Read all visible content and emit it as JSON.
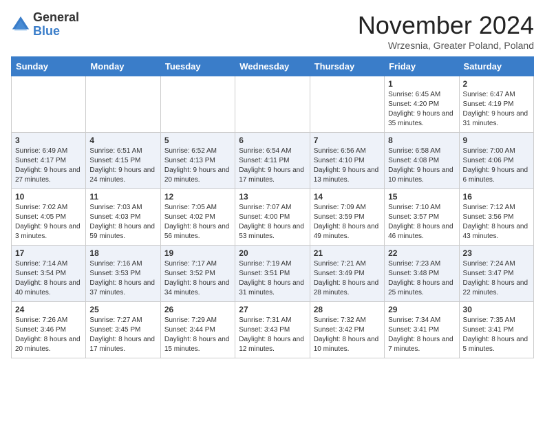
{
  "header": {
    "logo_line1": "General",
    "logo_line2": "Blue",
    "month": "November 2024",
    "location": "Wrzesnia, Greater Poland, Poland"
  },
  "days_of_week": [
    "Sunday",
    "Monday",
    "Tuesday",
    "Wednesday",
    "Thursday",
    "Friday",
    "Saturday"
  ],
  "weeks": [
    [
      {
        "day": "",
        "info": ""
      },
      {
        "day": "",
        "info": ""
      },
      {
        "day": "",
        "info": ""
      },
      {
        "day": "",
        "info": ""
      },
      {
        "day": "",
        "info": ""
      },
      {
        "day": "1",
        "info": "Sunrise: 6:45 AM\nSunset: 4:20 PM\nDaylight: 9 hours and 35 minutes."
      },
      {
        "day": "2",
        "info": "Sunrise: 6:47 AM\nSunset: 4:19 PM\nDaylight: 9 hours and 31 minutes."
      }
    ],
    [
      {
        "day": "3",
        "info": "Sunrise: 6:49 AM\nSunset: 4:17 PM\nDaylight: 9 hours and 27 minutes."
      },
      {
        "day": "4",
        "info": "Sunrise: 6:51 AM\nSunset: 4:15 PM\nDaylight: 9 hours and 24 minutes."
      },
      {
        "day": "5",
        "info": "Sunrise: 6:52 AM\nSunset: 4:13 PM\nDaylight: 9 hours and 20 minutes."
      },
      {
        "day": "6",
        "info": "Sunrise: 6:54 AM\nSunset: 4:11 PM\nDaylight: 9 hours and 17 minutes."
      },
      {
        "day": "7",
        "info": "Sunrise: 6:56 AM\nSunset: 4:10 PM\nDaylight: 9 hours and 13 minutes."
      },
      {
        "day": "8",
        "info": "Sunrise: 6:58 AM\nSunset: 4:08 PM\nDaylight: 9 hours and 10 minutes."
      },
      {
        "day": "9",
        "info": "Sunrise: 7:00 AM\nSunset: 4:06 PM\nDaylight: 9 hours and 6 minutes."
      }
    ],
    [
      {
        "day": "10",
        "info": "Sunrise: 7:02 AM\nSunset: 4:05 PM\nDaylight: 9 hours and 3 minutes."
      },
      {
        "day": "11",
        "info": "Sunrise: 7:03 AM\nSunset: 4:03 PM\nDaylight: 8 hours and 59 minutes."
      },
      {
        "day": "12",
        "info": "Sunrise: 7:05 AM\nSunset: 4:02 PM\nDaylight: 8 hours and 56 minutes."
      },
      {
        "day": "13",
        "info": "Sunrise: 7:07 AM\nSunset: 4:00 PM\nDaylight: 8 hours and 53 minutes."
      },
      {
        "day": "14",
        "info": "Sunrise: 7:09 AM\nSunset: 3:59 PM\nDaylight: 8 hours and 49 minutes."
      },
      {
        "day": "15",
        "info": "Sunrise: 7:10 AM\nSunset: 3:57 PM\nDaylight: 8 hours and 46 minutes."
      },
      {
        "day": "16",
        "info": "Sunrise: 7:12 AM\nSunset: 3:56 PM\nDaylight: 8 hours and 43 minutes."
      }
    ],
    [
      {
        "day": "17",
        "info": "Sunrise: 7:14 AM\nSunset: 3:54 PM\nDaylight: 8 hours and 40 minutes."
      },
      {
        "day": "18",
        "info": "Sunrise: 7:16 AM\nSunset: 3:53 PM\nDaylight: 8 hours and 37 minutes."
      },
      {
        "day": "19",
        "info": "Sunrise: 7:17 AM\nSunset: 3:52 PM\nDaylight: 8 hours and 34 minutes."
      },
      {
        "day": "20",
        "info": "Sunrise: 7:19 AM\nSunset: 3:51 PM\nDaylight: 8 hours and 31 minutes."
      },
      {
        "day": "21",
        "info": "Sunrise: 7:21 AM\nSunset: 3:49 PM\nDaylight: 8 hours and 28 minutes."
      },
      {
        "day": "22",
        "info": "Sunrise: 7:23 AM\nSunset: 3:48 PM\nDaylight: 8 hours and 25 minutes."
      },
      {
        "day": "23",
        "info": "Sunrise: 7:24 AM\nSunset: 3:47 PM\nDaylight: 8 hours and 22 minutes."
      }
    ],
    [
      {
        "day": "24",
        "info": "Sunrise: 7:26 AM\nSunset: 3:46 PM\nDaylight: 8 hours and 20 minutes."
      },
      {
        "day": "25",
        "info": "Sunrise: 7:27 AM\nSunset: 3:45 PM\nDaylight: 8 hours and 17 minutes."
      },
      {
        "day": "26",
        "info": "Sunrise: 7:29 AM\nSunset: 3:44 PM\nDaylight: 8 hours and 15 minutes."
      },
      {
        "day": "27",
        "info": "Sunrise: 7:31 AM\nSunset: 3:43 PM\nDaylight: 8 hours and 12 minutes."
      },
      {
        "day": "28",
        "info": "Sunrise: 7:32 AM\nSunset: 3:42 PM\nDaylight: 8 hours and 10 minutes."
      },
      {
        "day": "29",
        "info": "Sunrise: 7:34 AM\nSunset: 3:41 PM\nDaylight: 8 hours and 7 minutes."
      },
      {
        "day": "30",
        "info": "Sunrise: 7:35 AM\nSunset: 3:41 PM\nDaylight: 8 hours and 5 minutes."
      }
    ]
  ]
}
